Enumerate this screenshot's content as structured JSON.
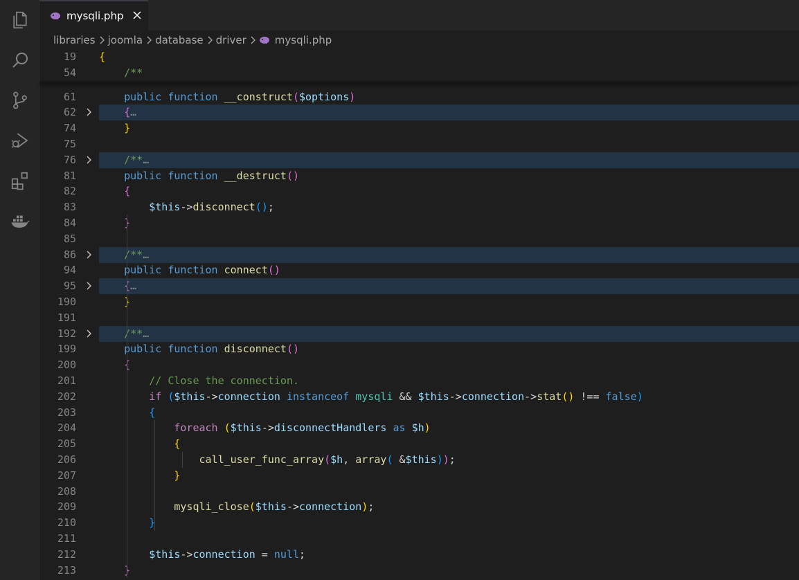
{
  "activity_bar": {
    "icons": [
      "explorer-icon",
      "search-icon",
      "source-control-icon",
      "run-debug-icon",
      "extensions-icon",
      "docker-icon"
    ]
  },
  "tab": {
    "label": "mysqli.php",
    "icon": "php-elephant-icon"
  },
  "breadcrumb": {
    "items": [
      "libraries",
      "joomla",
      "database",
      "driver",
      "mysqli.php"
    ]
  },
  "editor": {
    "sticky_lines": [
      {
        "num": "19",
        "code": "{"
      },
      {
        "num": "54",
        "code": "    /**"
      }
    ],
    "lines": [
      {
        "num": "61",
        "code": "    public function __construct($options)"
      },
      {
        "num": "62",
        "code": "    {…",
        "folded": true
      },
      {
        "num": "74",
        "code": "    }"
      },
      {
        "num": "75",
        "code": ""
      },
      {
        "num": "76",
        "code": "    /**…",
        "folded": true
      },
      {
        "num": "81",
        "code": "    public function __destruct()"
      },
      {
        "num": "82",
        "code": "    {"
      },
      {
        "num": "83",
        "code": "        $this->disconnect();"
      },
      {
        "num": "84",
        "code": "    }"
      },
      {
        "num": "85",
        "code": ""
      },
      {
        "num": "86",
        "code": "    /**…",
        "folded": true
      },
      {
        "num": "94",
        "code": "    public function connect()"
      },
      {
        "num": "95",
        "code": "    {…",
        "folded": true
      },
      {
        "num": "190",
        "code": "    }"
      },
      {
        "num": "191",
        "code": ""
      },
      {
        "num": "192",
        "code": "    /**…",
        "folded": true
      },
      {
        "num": "199",
        "code": "    public function disconnect()"
      },
      {
        "num": "200",
        "code": "    {"
      },
      {
        "num": "201",
        "code": "        // Close the connection."
      },
      {
        "num": "202",
        "code": "        if ($this->connection instanceof mysqli && $this->connection->stat() !== false)"
      },
      {
        "num": "203",
        "code": "        {"
      },
      {
        "num": "204",
        "code": "            foreach ($this->disconnectHandlers as $h)"
      },
      {
        "num": "205",
        "code": "            {"
      },
      {
        "num": "206",
        "code": "                call_user_func_array($h, array( &$this));"
      },
      {
        "num": "207",
        "code": "            }"
      },
      {
        "num": "208",
        "code": ""
      },
      {
        "num": "209",
        "code": "            mysqli_close($this->connection);"
      },
      {
        "num": "210",
        "code": "        }"
      },
      {
        "num": "211",
        "code": ""
      },
      {
        "num": "212",
        "code": "        $this->connection = null;"
      },
      {
        "num": "213",
        "code": "    }"
      }
    ]
  },
  "colors": {
    "background": "#1e1e1e",
    "keyword": "#569cd6",
    "function": "#dcdcaa",
    "variable": "#9cdcfe",
    "comment": "#6a9955",
    "fold_highlight": "#223346"
  }
}
